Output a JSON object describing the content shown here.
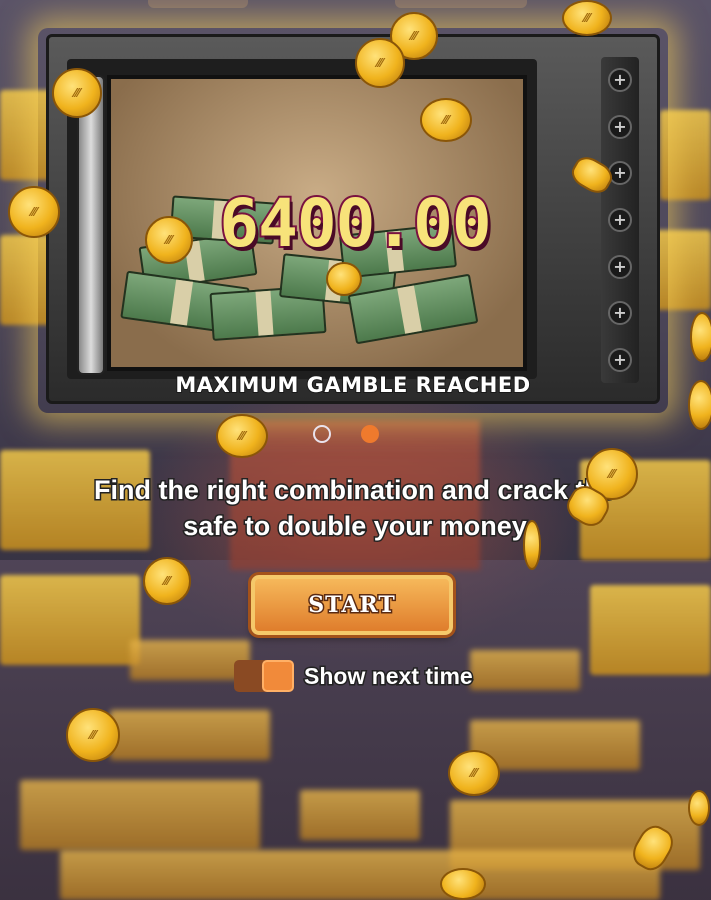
{
  "game": {
    "win_amount": "6400.00",
    "safe_caption": "MAXIMUM GAMBLE REACHED",
    "instructions_line1": "Find the right combination and crack the",
    "instructions_line2": "safe to double your money",
    "start_label": "START",
    "show_next_time_label": "Show next time",
    "show_next_time_enabled": true,
    "pagination": {
      "total": 2,
      "active_index": 1
    },
    "coin_symbol": "⁄⁄⁄"
  },
  "colors": {
    "accent_orange": "#ef7a2d",
    "amount_fill": "#f7e37a",
    "amount_stroke": "#7a1240",
    "gold": "#f0b31d"
  }
}
